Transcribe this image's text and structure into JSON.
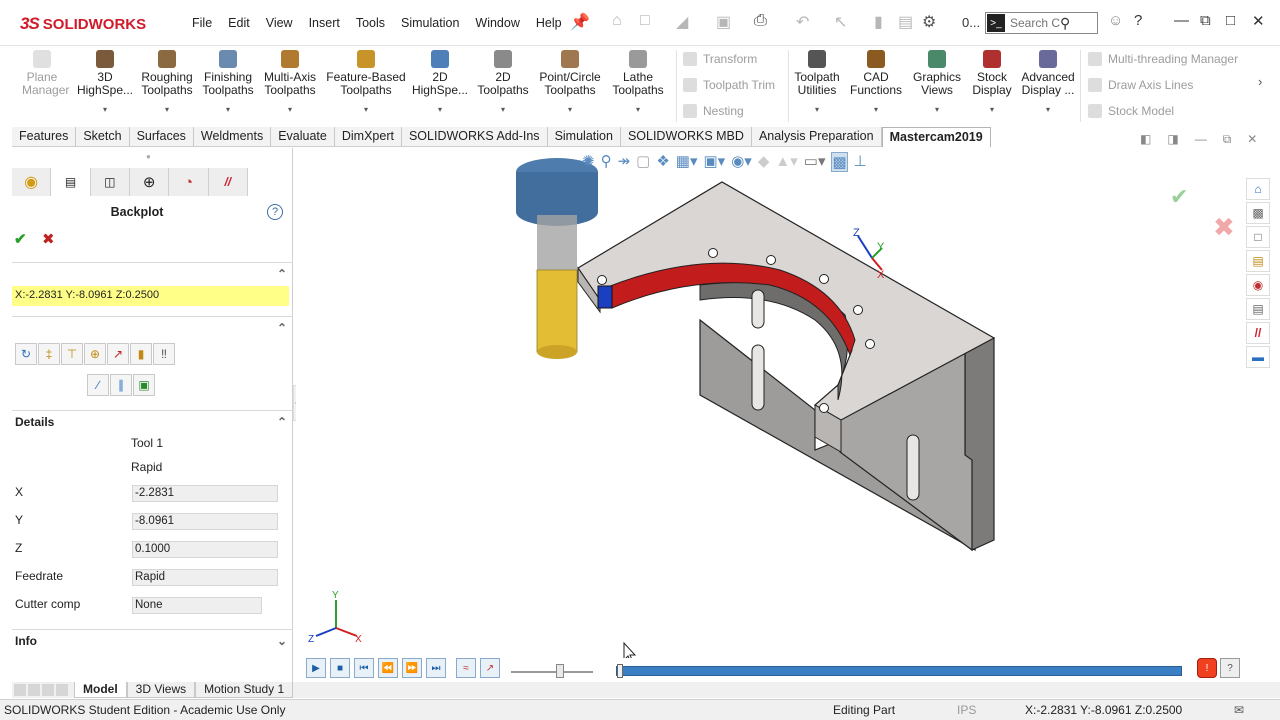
{
  "app": {
    "logo_ds": "3S",
    "logo_text": "SOLIDWORKS"
  },
  "menu": [
    "File",
    "Edit",
    "View",
    "Insert",
    "Tools",
    "Simulation",
    "Window",
    "Help"
  ],
  "quick_access": {
    "counter": "0..."
  },
  "search": {
    "placeholder": "Search Co"
  },
  "ribbon": {
    "plane_manager": "Plane\nManager",
    "buttons": [
      {
        "label": "3D\nHighSpe...",
        "icon_color": "#7a5a3a"
      },
      {
        "label": "Roughing\nToolpaths",
        "icon_color": "#8b6a42"
      },
      {
        "label": "Finishing\nToolpaths",
        "icon_color": "#6a8ab0"
      },
      {
        "label": "Multi-Axis\nToolpaths",
        "icon_color": "#b07a30"
      },
      {
        "label": "Feature-Based\nToolpaths",
        "icon_color": "#c8942a"
      },
      {
        "label": "2D\nHighSpe...",
        "icon_color": "#4f7fb8"
      },
      {
        "label": "2D\nToolpaths",
        "icon_color": "#8a8a8a"
      },
      {
        "label": "Point/Circle\nToolpaths",
        "icon_color": "#a07850"
      },
      {
        "label": "Lathe\nToolpaths",
        "icon_color": "#9a9a9a"
      }
    ],
    "small_left": [
      "Transform",
      "Toolpath Trim",
      "Nesting"
    ],
    "buttons2": [
      {
        "label": "Toolpath\nUtilities",
        "icon_color": "#555555"
      },
      {
        "label": "CAD\nFunctions",
        "icon_color": "#8a5a20"
      },
      {
        "label": "Graphics\nViews",
        "icon_color": "#4a8a6a"
      },
      {
        "label": "Stock\nDisplay",
        "icon_color": "#b03030"
      },
      {
        "label": "Advanced\nDisplay ...",
        "icon_color": "#6a6a9a"
      }
    ],
    "small_right": [
      "Multi-threading Manager",
      "Draw Axis Lines",
      "Stock Model"
    ]
  },
  "tabs": [
    "Features",
    "Sketch",
    "Surfaces",
    "Weldments",
    "Evaluate",
    "DimXpert",
    "SOLIDWORKS Add-Ins",
    "Simulation",
    "SOLIDWORKS MBD",
    "Analysis Preparation",
    "Mastercam2019"
  ],
  "active_tab": "Mastercam2019",
  "panel": {
    "title": "Backplot",
    "coords": "X:-2.2831   Y:-8.0961   Z:0.2500",
    "details_label": "Details",
    "tool": "Tool 1",
    "motion": "Rapid",
    "fields": [
      {
        "label": "X",
        "value": "-2.2831"
      },
      {
        "label": "Y",
        "value": "-8.0961"
      },
      {
        "label": "Z",
        "value": "0.1000"
      },
      {
        "label": "Feedrate",
        "value": "Rapid"
      },
      {
        "label": "Cutter comp",
        "value": "None"
      }
    ],
    "info_label": "Info"
  },
  "triad": {
    "x": "X",
    "y": "Y",
    "z": "Z"
  },
  "bottom_tabs": [
    "Model",
    "3D Views",
    "Motion Study 1"
  ],
  "status": {
    "left": "SOLIDWORKS Student Edition - Academic Use Only",
    "mode": "Editing Part",
    "units": "IPS",
    "coords": "X:-2.2831   Y:-8.0961   Z:0.2500"
  },
  "colors": {
    "accent": "#d01b2a",
    "coord_highlight": "#ffff88",
    "part": "#d9d6d3",
    "path": "#c21c1c",
    "tool_holder": "#3a6ea5",
    "tool_flute": "#e0b820"
  }
}
